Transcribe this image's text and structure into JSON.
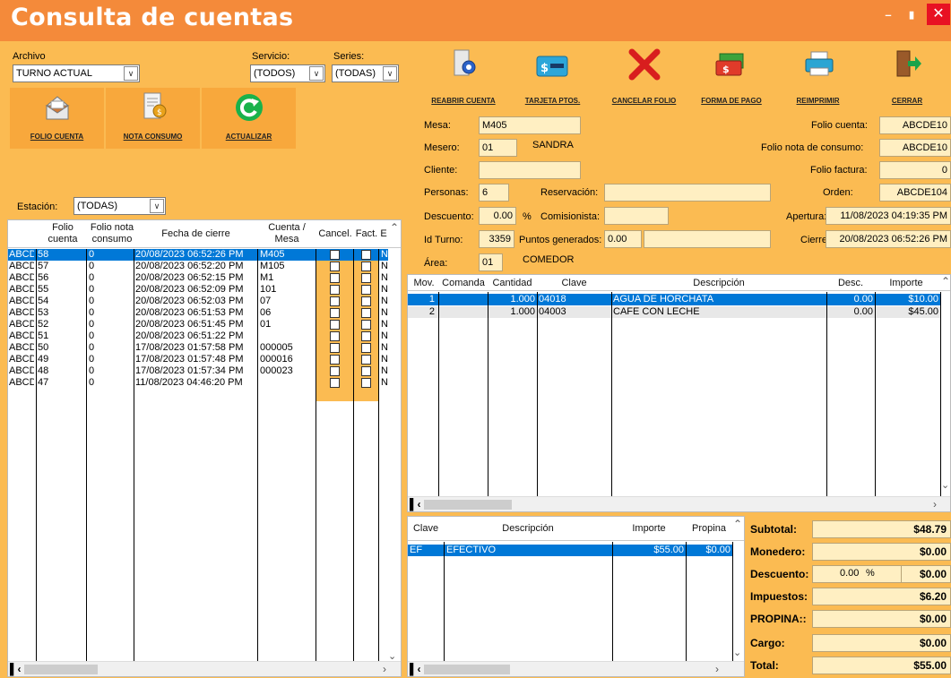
{
  "window": {
    "title": "Consulta de cuentas",
    "minimize": "–",
    "restore": "🗗",
    "close": "✕"
  },
  "filters": {
    "archivo_label": "Archivo",
    "archivo_value": "TURNO ACTUAL",
    "servicio_label": "Servicio:",
    "servicio_value": "(TODOS)",
    "series_label": "Series:",
    "series_value": "(TODAS)",
    "estacion_label": "Estación:",
    "estacion_value": "(TODAS)"
  },
  "left_buttons": {
    "folio_cuenta": "FOLIO CUENTA",
    "nota_consumo": "NOTA CONSUMO",
    "actualizar": "ACTUALIZAR"
  },
  "toolbar": {
    "reabrir": "REABRIR CUENTA",
    "tarjeta": "TARJETA PTOS.",
    "cancelar": "CANCELAR FOLIO",
    "forma_pago": "FORMA DE PAGO",
    "reimprimir": "REIMPRIMIR",
    "cerrar": "CERRAR"
  },
  "accounts": {
    "headers": {
      "folio1": "Folio",
      "folio2": "cuenta",
      "nota1": "Folio nota",
      "nota2": "consumo",
      "fecha": "Fecha de cierre",
      "cuenta1": "Cuenta /",
      "cuenta2": "Mesa",
      "cancel": "Cancel.",
      "fact": "Fact.",
      "e": "E"
    },
    "rows": [
      {
        "prefix": "ABCD",
        "folio": "58",
        "nota": "0",
        "fecha": "20/08/2023 06:52:26 PM",
        "mesa": "M405",
        "e": "N"
      },
      {
        "prefix": "ABCD",
        "folio": "57",
        "nota": "0",
        "fecha": "20/08/2023 06:52:20 PM",
        "mesa": "M105",
        "e": "N"
      },
      {
        "prefix": "ABCD",
        "folio": "56",
        "nota": "0",
        "fecha": "20/08/2023 06:52:15 PM",
        "mesa": "M1",
        "e": "N"
      },
      {
        "prefix": "ABCD",
        "folio": "55",
        "nota": "0",
        "fecha": "20/08/2023 06:52:09 PM",
        "mesa": "101",
        "e": "N"
      },
      {
        "prefix": "ABCD",
        "folio": "54",
        "nota": "0",
        "fecha": "20/08/2023 06:52:03 PM",
        "mesa": "07",
        "e": "N"
      },
      {
        "prefix": "ABCD",
        "folio": "53",
        "nota": "0",
        "fecha": "20/08/2023 06:51:53 PM",
        "mesa": "06",
        "e": "N"
      },
      {
        "prefix": "ABCD",
        "folio": "52",
        "nota": "0",
        "fecha": "20/08/2023 06:51:45 PM",
        "mesa": "01",
        "e": "N"
      },
      {
        "prefix": "ABCD",
        "folio": "51",
        "nota": "0",
        "fecha": "20/08/2023 06:51:22 PM",
        "mesa": "",
        "e": "N"
      },
      {
        "prefix": "ABCD",
        "folio": "50",
        "nota": "0",
        "fecha": "17/08/2023 01:57:58 PM",
        "mesa": "000005",
        "e": "N"
      },
      {
        "prefix": "ABCD",
        "folio": "49",
        "nota": "0",
        "fecha": "17/08/2023 01:57:48 PM",
        "mesa": "000016",
        "e": "N"
      },
      {
        "prefix": "ABCD",
        "folio": "48",
        "nota": "0",
        "fecha": "17/08/2023 01:57:34 PM",
        "mesa": "000023",
        "e": "N"
      },
      {
        "prefix": "ABCD",
        "folio": "47",
        "nota": "0",
        "fecha": "11/08/2023 04:46:20 PM",
        "mesa": "",
        "e": "N"
      }
    ]
  },
  "detail": {
    "mesa_label": "Mesa:",
    "mesa": "M405",
    "mesero_label": "Mesero:",
    "mesero_code": "01",
    "mesero_name": "SANDRA",
    "cliente_label": "Cliente:",
    "cliente": "",
    "personas_label": "Personas:",
    "personas": "6",
    "reservacion_label": "Reservación:",
    "reservacion": "",
    "descuento_label": "Descuento:",
    "descuento": "0.00",
    "pct": "%",
    "comisionista_label": "Comisionista:",
    "comisionista": "",
    "turno_label": "Id Turno:",
    "turno": "3359",
    "puntos_label": "Puntos generados:",
    "puntos": "0.00",
    "area_label": "Área:",
    "area_code": "01",
    "area_name": "COMEDOR",
    "folio_cuenta_label": "Folio cuenta:",
    "folio_cuenta": "ABCDE10",
    "folio_nota_label": "Folio nota de consumo:",
    "folio_nota": "ABCDE10",
    "folio_factura_label": "Folio factura:",
    "folio_factura": "0",
    "orden_label": "Orden:",
    "orden": "ABCDE104",
    "apertura_label": "Apertura:",
    "apertura": "11/08/2023 04:19:35 PM",
    "cierre_label": "Cierre:",
    "cierre": "20/08/2023 06:52:26 PM"
  },
  "items": {
    "headers": {
      "mov": "Mov.",
      "comanda": "Comanda",
      "cantidad": "Cantidad",
      "clave": "Clave",
      "descripcion": "Descripción",
      "desc": "Desc.",
      "importe": "Importe"
    },
    "rows": [
      {
        "mov": "1",
        "comanda": "",
        "cantidad": "1.000",
        "clave": "04018",
        "descripcion": "AGUA DE HORCHATA",
        "desc": "0.00",
        "importe": "$10.00"
      },
      {
        "mov": "2",
        "comanda": "",
        "cantidad": "1.000",
        "clave": "04003",
        "descripcion": "CAFE CON LECHE",
        "desc": "0.00",
        "importe": "$45.00"
      }
    ]
  },
  "payments": {
    "headers": {
      "clave": "Clave",
      "descripcion": "Descripción",
      "importe": "Importe",
      "propina": "Propina"
    },
    "rows": [
      {
        "clave": "EF",
        "descripcion": "EFECTIVO",
        "importe": "$55.00",
        "propina": "$0.00"
      }
    ]
  },
  "totals": {
    "subtotal_label": "Subtotal:",
    "subtotal": "$48.79",
    "monedero_label": "Monedero:",
    "monedero": "$0.00",
    "descuento_label": "Descuento:",
    "descuento_pct": "0.00",
    "pct": "%",
    "descuento": "$0.00",
    "impuestos_label": "Impuestos:",
    "impuestos": "$6.20",
    "propina_label": "PROPINA::",
    "propina": "$0.00",
    "cargo_label": "Cargo:",
    "cargo": "$0.00",
    "total_label": "Total:",
    "total": "$55.00"
  }
}
